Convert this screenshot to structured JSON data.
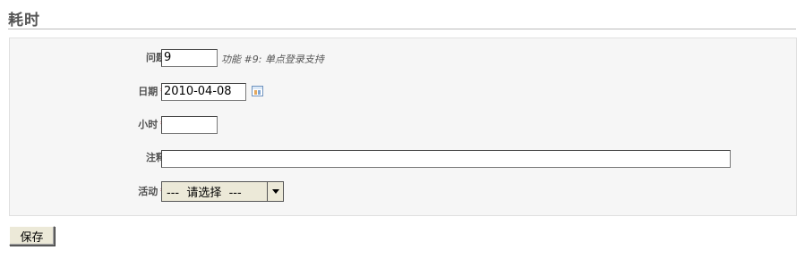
{
  "page": {
    "title": "耗时"
  },
  "form": {
    "issue": {
      "label": "问题",
      "value": "9",
      "hint": "功能 #9: 单点登录支持"
    },
    "date": {
      "label": "日期",
      "required_mark": "*",
      "value": "2010-04-08",
      "icon": "calendar-icon"
    },
    "hours": {
      "label": "小时",
      "required_mark": "*",
      "value": ""
    },
    "comment": {
      "label": "注释",
      "value": ""
    },
    "activity": {
      "label": "活动",
      "required_mark": "*",
      "selected": "---  请选择  ---",
      "icon": "chevron-down-icon"
    }
  },
  "actions": {
    "save_label": "保存"
  }
}
